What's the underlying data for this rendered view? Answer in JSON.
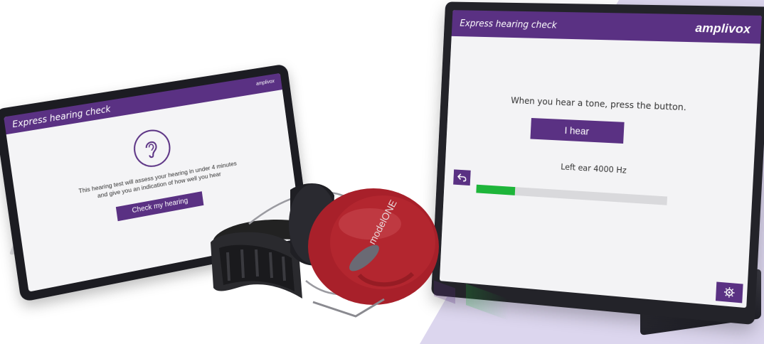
{
  "colors": {
    "brand_purple": "#5a3183",
    "progress_green": "#1eb53a",
    "backdrop_lavender": "#dcd6ee",
    "earcup_red": "#a8202a"
  },
  "tablet": {
    "header_title": "Express hearing check",
    "brand": "amplivox",
    "ear_icon": "ear-icon",
    "description_lines": [
      "This hearing test will assess your hearing in under 4 minutes",
      "and give you an indication of how well you hear"
    ],
    "cta_label": "Check my hearing"
  },
  "monitor": {
    "header_title": "Express hearing check",
    "brand": "amplivox",
    "instruction": "When you hear a tone, press the button.",
    "hear_button_label": "I hear",
    "ear_frequency_label": "Left ear 4000 Hz",
    "progress_fraction": 0.21,
    "back_icon": "back-arrow-icon",
    "settings_icon": "gear-icon"
  },
  "headphones": {
    "model_text": "modelONE"
  }
}
